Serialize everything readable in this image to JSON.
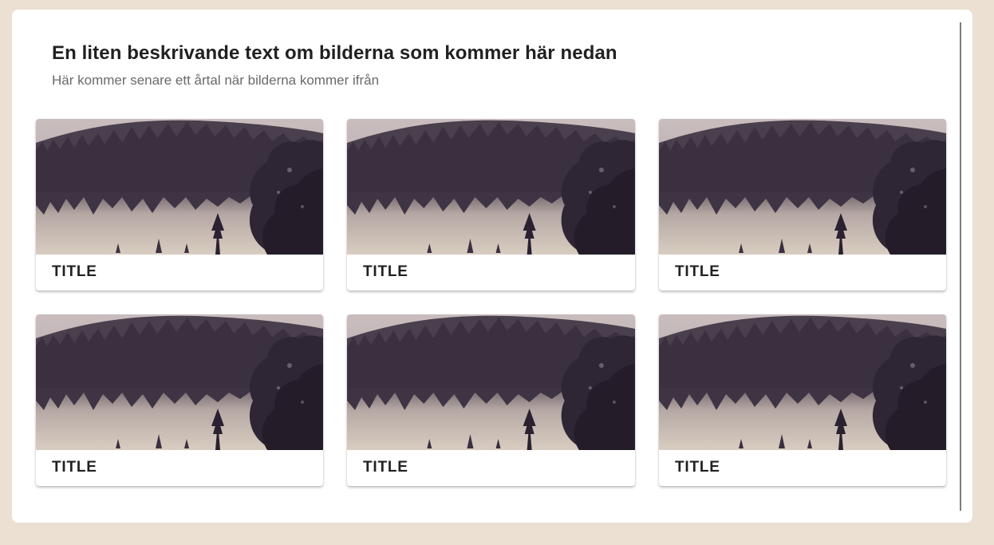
{
  "header": {
    "title": "En liten beskrivande text om bilderna som kommer här nedan",
    "subtitle": "Här kommer senare ett årtal när bilderna kommer ifrån"
  },
  "cards": [
    {
      "title": "TITLE",
      "image": "forest-lake-photo"
    },
    {
      "title": "TITLE",
      "image": "forest-lake-photo"
    },
    {
      "title": "TITLE",
      "image": "forest-lake-photo"
    },
    {
      "title": "TITLE",
      "image": "forest-lake-photo"
    },
    {
      "title": "TITLE",
      "image": "forest-lake-photo"
    },
    {
      "title": "TITLE",
      "image": "forest-lake-photo"
    }
  ],
  "colors": {
    "page_background": "#ebe0d2",
    "panel_background": "#ffffff",
    "heading_text": "#212121",
    "subheading_text": "#6a6a6a"
  }
}
